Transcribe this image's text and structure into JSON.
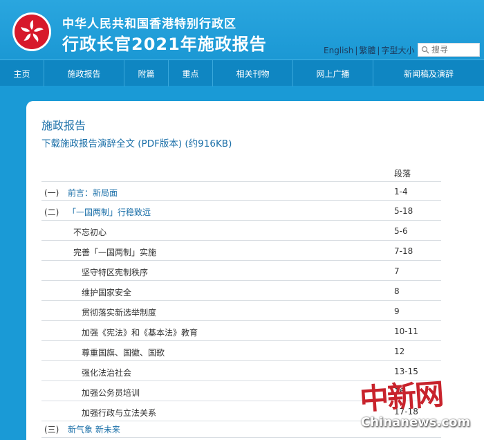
{
  "header": {
    "subtitle": "中华人民共和国香港特别行政区",
    "title": "行政长官2021年施政报告",
    "links": [
      "English",
      "繁體",
      "字型大小"
    ],
    "search_placeholder": "搜寻"
  },
  "nav": {
    "items": [
      "主页",
      "施政报告",
      "附篇",
      "重点",
      "相关刊物",
      "网上广播",
      "新闻稿及演辞"
    ]
  },
  "content": {
    "heading": "施政报告",
    "download": "下载施政报告演辞全文 (PDF版本) (约916KB)",
    "column_header": "段落",
    "toc": [
      {
        "num": "(一)",
        "label": "前言：新局面",
        "para": "1-4",
        "level": 1
      },
      {
        "num": "(二)",
        "label": "「一国两制」行稳致远",
        "para": "5-18",
        "level": 1
      },
      {
        "num": "",
        "label": "不忘初心",
        "para": "5-6",
        "level": 2
      },
      {
        "num": "",
        "label": "完善「一国两制」实施",
        "para": "7-18",
        "level": 2
      },
      {
        "num": "",
        "label": "坚守特区宪制秩序",
        "para": "7",
        "level": 3
      },
      {
        "num": "",
        "label": "维护国家安全",
        "para": "8",
        "level": 3
      },
      {
        "num": "",
        "label": "贯彻落实新选举制度",
        "para": "9",
        "level": 3
      },
      {
        "num": "",
        "label": "加强《宪法》和《基本法》教育",
        "para": "10-11",
        "level": 3
      },
      {
        "num": "",
        "label": "尊重国旗、国徽、国歌",
        "para": "12",
        "level": 3
      },
      {
        "num": "",
        "label": "强化法治社会",
        "para": "13-15",
        "level": 3
      },
      {
        "num": "",
        "label": "加强公务员培训",
        "para": "16",
        "level": 3
      },
      {
        "num": "",
        "label": "加强行政与立法关系",
        "para": "17-18",
        "level": 3
      },
      {
        "num": "(三)",
        "label": "新气象  新未来",
        "para": "",
        "level": 1
      }
    ]
  },
  "watermark": {
    "cn": "中新网",
    "en": "Chinanews.com"
  },
  "colors": {
    "header_bg": "#1b98d4",
    "nav_bg": "#0f86c2",
    "link_blue": "#1a6fa8",
    "emblem_red": "#d7192b"
  }
}
